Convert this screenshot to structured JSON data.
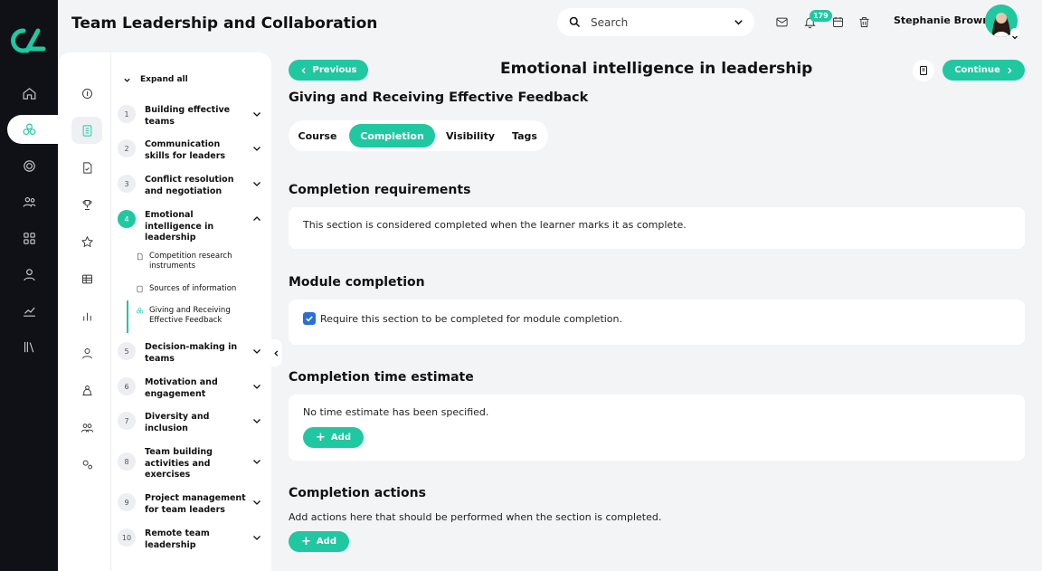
{
  "app": {
    "title": "Team Leadership and Collaboration"
  },
  "header": {
    "search_placeholder": "Search",
    "notification_count": "179",
    "user_name": "Stephanie Brown"
  },
  "outline": {
    "expand_all": "Expand all",
    "modules": [
      {
        "num": "1",
        "label": "Building effective teams"
      },
      {
        "num": "2",
        "label": "Communication skills for leaders"
      },
      {
        "num": "3",
        "label": "Conflict resolution and negotiation"
      },
      {
        "num": "4",
        "label": "Emotional intelligence in leadership"
      },
      {
        "num": "5",
        "label": "Decision-making in teams"
      },
      {
        "num": "6",
        "label": "Motivation and engagement"
      },
      {
        "num": "7",
        "label": "Diversity and inclusion"
      },
      {
        "num": "8",
        "label": "Team building activities and exercises"
      },
      {
        "num": "9",
        "label": "Project management for team leaders"
      },
      {
        "num": "10",
        "label": "Remote team leadership"
      }
    ],
    "subitems": [
      {
        "label": "Competition research instruments"
      },
      {
        "label": "Sources of information"
      },
      {
        "label": "Giving and Receiving Effective Feedback"
      }
    ]
  },
  "main": {
    "previous": "Previous",
    "continue": "Continue",
    "page_title": "Emotional intelligence in leadership",
    "section_title": "Giving and Receiving Effective Feedback",
    "tabs": [
      "Course",
      "Completion",
      "Visibility",
      "Tags"
    ],
    "completion_requirements": {
      "heading": "Completion requirements",
      "text": "This section is considered completed when the learner marks it as complete."
    },
    "module_completion": {
      "heading": "Module completion",
      "checkbox_label": "Require this section to be completed for module completion.",
      "checked": true
    },
    "time_estimate": {
      "heading": "Completion time estimate",
      "text": "No time estimate has been specified.",
      "add_label": "Add"
    },
    "actions": {
      "heading": "Completion actions",
      "text": "Add actions here that should be performed when the section is completed.",
      "add_label": "Add"
    }
  },
  "colors": {
    "accent": "#1fc8a0",
    "rail": "#0f1117",
    "checkbox": "#2a6fd6"
  }
}
